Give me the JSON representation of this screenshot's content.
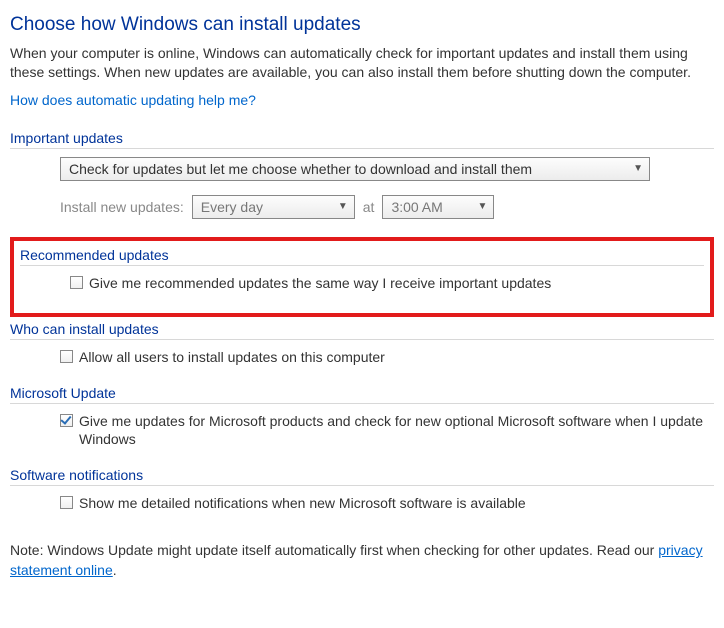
{
  "title": "Choose how Windows can install updates",
  "intro": "When your computer is online, Windows can automatically check for important updates and install them using these settings. When new updates are available, you can also install them before shutting down the computer.",
  "help_link": "How does automatic updating help me?",
  "sections": {
    "important": {
      "header": "Important updates",
      "mode_selected": "Check for updates but let me choose whether to download and install them",
      "schedule_label": "Install new updates:",
      "day_selected": "Every day",
      "at_label": "at",
      "time_selected": "3:00 AM"
    },
    "recommended": {
      "header": "Recommended updates",
      "checkbox_label": "Give me recommended updates the same way I receive important updates",
      "checked": false
    },
    "who": {
      "header": "Who can install updates",
      "checkbox_label": "Allow all users to install updates on this computer",
      "checked": false
    },
    "msupdate": {
      "header": "Microsoft Update",
      "checkbox_label": "Give me updates for Microsoft products and check for new optional Microsoft software when I update Windows",
      "checked": true
    },
    "notifications": {
      "header": "Software notifications",
      "checkbox_label": "Show me detailed notifications when new Microsoft software is available",
      "checked": false
    }
  },
  "footer": {
    "note_prefix": "Note: Windows Update might update itself automatically first when checking for other updates.  Read our ",
    "link_text": "privacy statement online",
    "note_suffix": "."
  }
}
